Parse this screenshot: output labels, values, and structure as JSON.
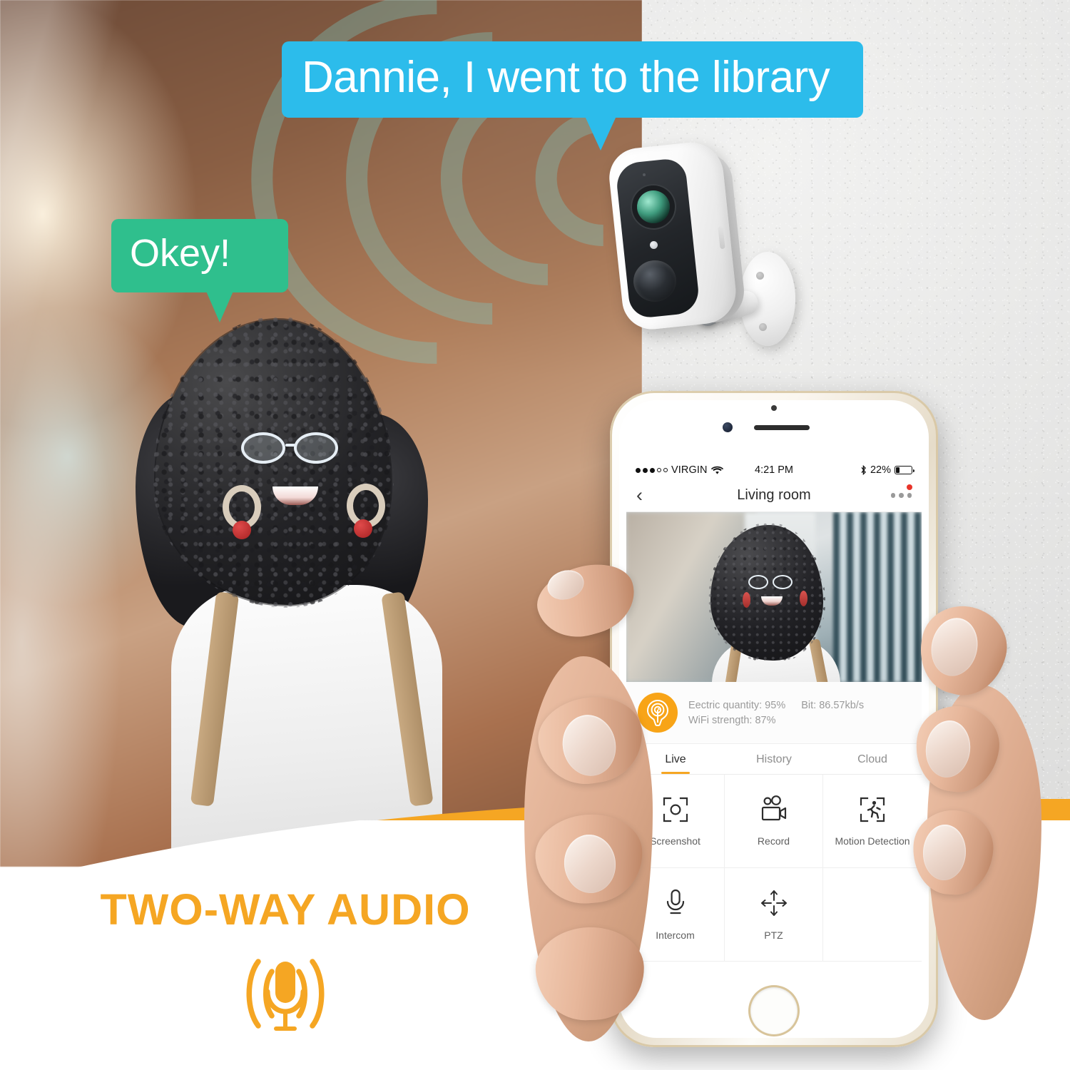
{
  "scene": {
    "speech_bubbles": [
      {
        "id": "remote-message",
        "text": "Dannie, I went to the library",
        "color": "#2cbceb"
      },
      {
        "id": "reply-message",
        "text": "Okey!",
        "color": "#2fbf8d"
      }
    ],
    "device": {
      "name": "wireless-security-camera"
    }
  },
  "phone": {
    "status_bar": {
      "carrier": "VIRGIN",
      "signal_filled": 3,
      "signal_empty": 2,
      "time": "4:21 PM",
      "bluetooth": "✶",
      "battery_percent": "22%"
    },
    "nav": {
      "back": "‹",
      "title": "Living room",
      "more": "···"
    },
    "info": {
      "electric_quantity": "Eectric quantity: 95%",
      "bit_rate": "Bit: 86.57kb/s",
      "wifi_strength": "WiFi strength: 87%",
      "badge_icon": "camera-bulb-icon",
      "badge_color": "#f8a417"
    },
    "tabs": [
      {
        "label": "Live",
        "active": true
      },
      {
        "label": "History",
        "active": false
      },
      {
        "label": "Cloud",
        "active": false
      }
    ],
    "actions": [
      {
        "label": "Screenshot",
        "icon": "screenshot-frame-icon"
      },
      {
        "label": "Record",
        "icon": "video-camera-icon"
      },
      {
        "label": "Motion Detection",
        "icon": "motion-person-icon"
      },
      {
        "label": "Intercom",
        "icon": "microphone-icon"
      },
      {
        "label": "PTZ",
        "icon": "four-arrows-icon"
      },
      {
        "label": "",
        "icon": ""
      }
    ]
  },
  "footer": {
    "title": "TWO-WAY AUDIO",
    "icon": "microphone-sound-waves-icon",
    "accent_color": "#f5a623"
  }
}
